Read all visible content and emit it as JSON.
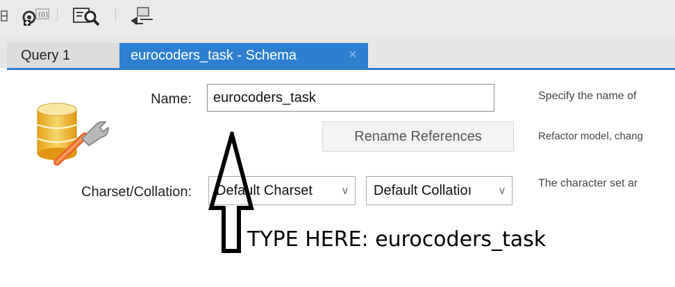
{
  "toolbar": {
    "icons": [
      "schema-icon",
      "add-gear-icon",
      "inspect-icon",
      "sync-icon"
    ]
  },
  "tabs": [
    {
      "label": "Query 1",
      "active": false
    },
    {
      "label": "eurocoders_task - Schema",
      "active": true,
      "close": "×"
    }
  ],
  "form": {
    "name_label": "Name:",
    "name_value": "eurocoders_task",
    "name_hint": "Specify the name of",
    "rename_button": "Rename References",
    "rename_hint": "Refactor model, chang",
    "charset_label": "Charset/Collation:",
    "charset_value": "Default Charset",
    "collation_value": "Default Collatioı",
    "charset_hint": "The character set ar"
  },
  "annotation": {
    "text": "TYPE HERE: eurocoders_task"
  },
  "colors": {
    "active_tab": "#2f7fd1",
    "toolbar_bg": "#eaeaea"
  }
}
